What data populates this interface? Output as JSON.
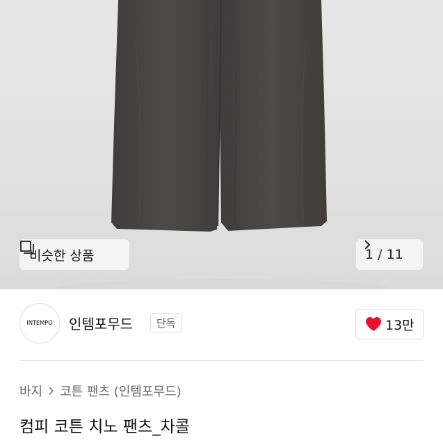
{
  "gallery": {
    "similar_label": "비슷한 상품",
    "counter": "1 / 11"
  },
  "seller": {
    "logo_text": "INTEMPO",
    "name": "인템포무드",
    "badge": "단독",
    "likes": "13만"
  },
  "breadcrumb": {
    "items": [
      "바지",
      "코튼 팬츠 (인템포무드)"
    ]
  },
  "product": {
    "title": "컴피 코튼 치노 팬츠_차콜"
  },
  "colors": {
    "heart": "#e8112d",
    "pants": "#4a4843"
  }
}
